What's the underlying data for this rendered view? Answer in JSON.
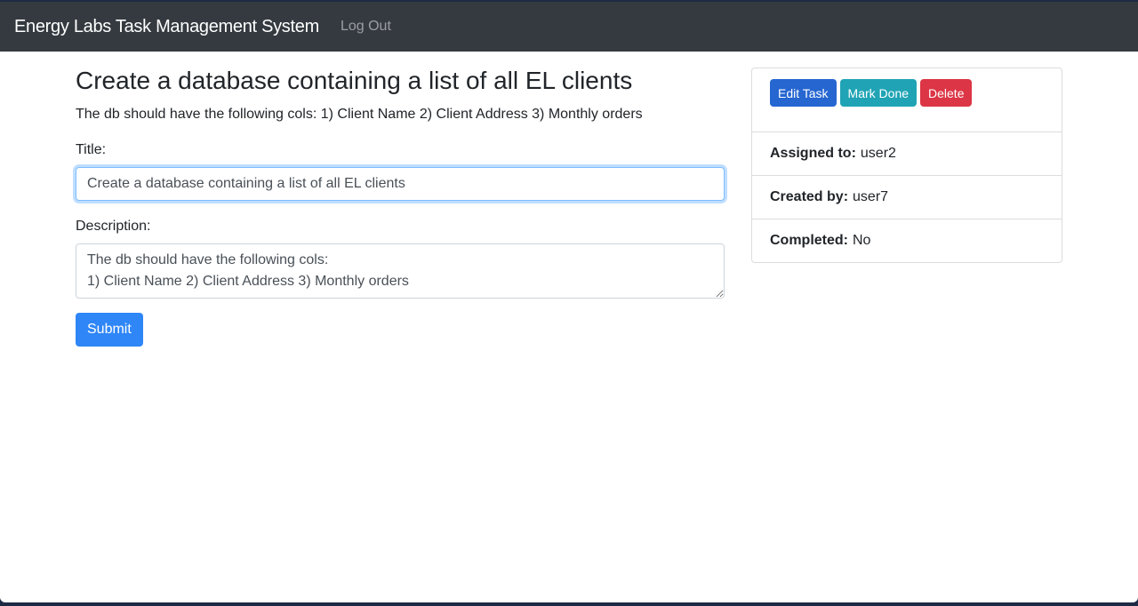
{
  "navbar": {
    "brand": "Energy Labs Task Management System",
    "logout_label": "Log Out"
  },
  "task": {
    "heading": "Create a database containing a list of all EL clients",
    "description": "The db should have the following cols: 1) Client Name 2) Client Address 3) Monthly orders"
  },
  "form": {
    "title_label": "Title:",
    "title_value": "Create a database containing a list of all EL clients",
    "description_label": "Description:",
    "description_value": "The db should have the following cols:\n1) Client Name 2) Client Address 3) Monthly orders",
    "submit_label": "Submit"
  },
  "sidebar": {
    "actions": {
      "edit_label": "Edit Task",
      "mark_done_label": "Mark Done",
      "delete_label": "Delete"
    },
    "details": [
      {
        "label": "Assigned to:",
        "value": "user2"
      },
      {
        "label": "Created by:",
        "value": "user7"
      },
      {
        "label": "Completed:",
        "value": "No"
      }
    ]
  },
  "colors": {
    "navbar_bg": "#343a40",
    "primary": "#2f86f6",
    "edit": "#2566d1",
    "info": "#20a4b5",
    "danger": "#dc3545"
  }
}
